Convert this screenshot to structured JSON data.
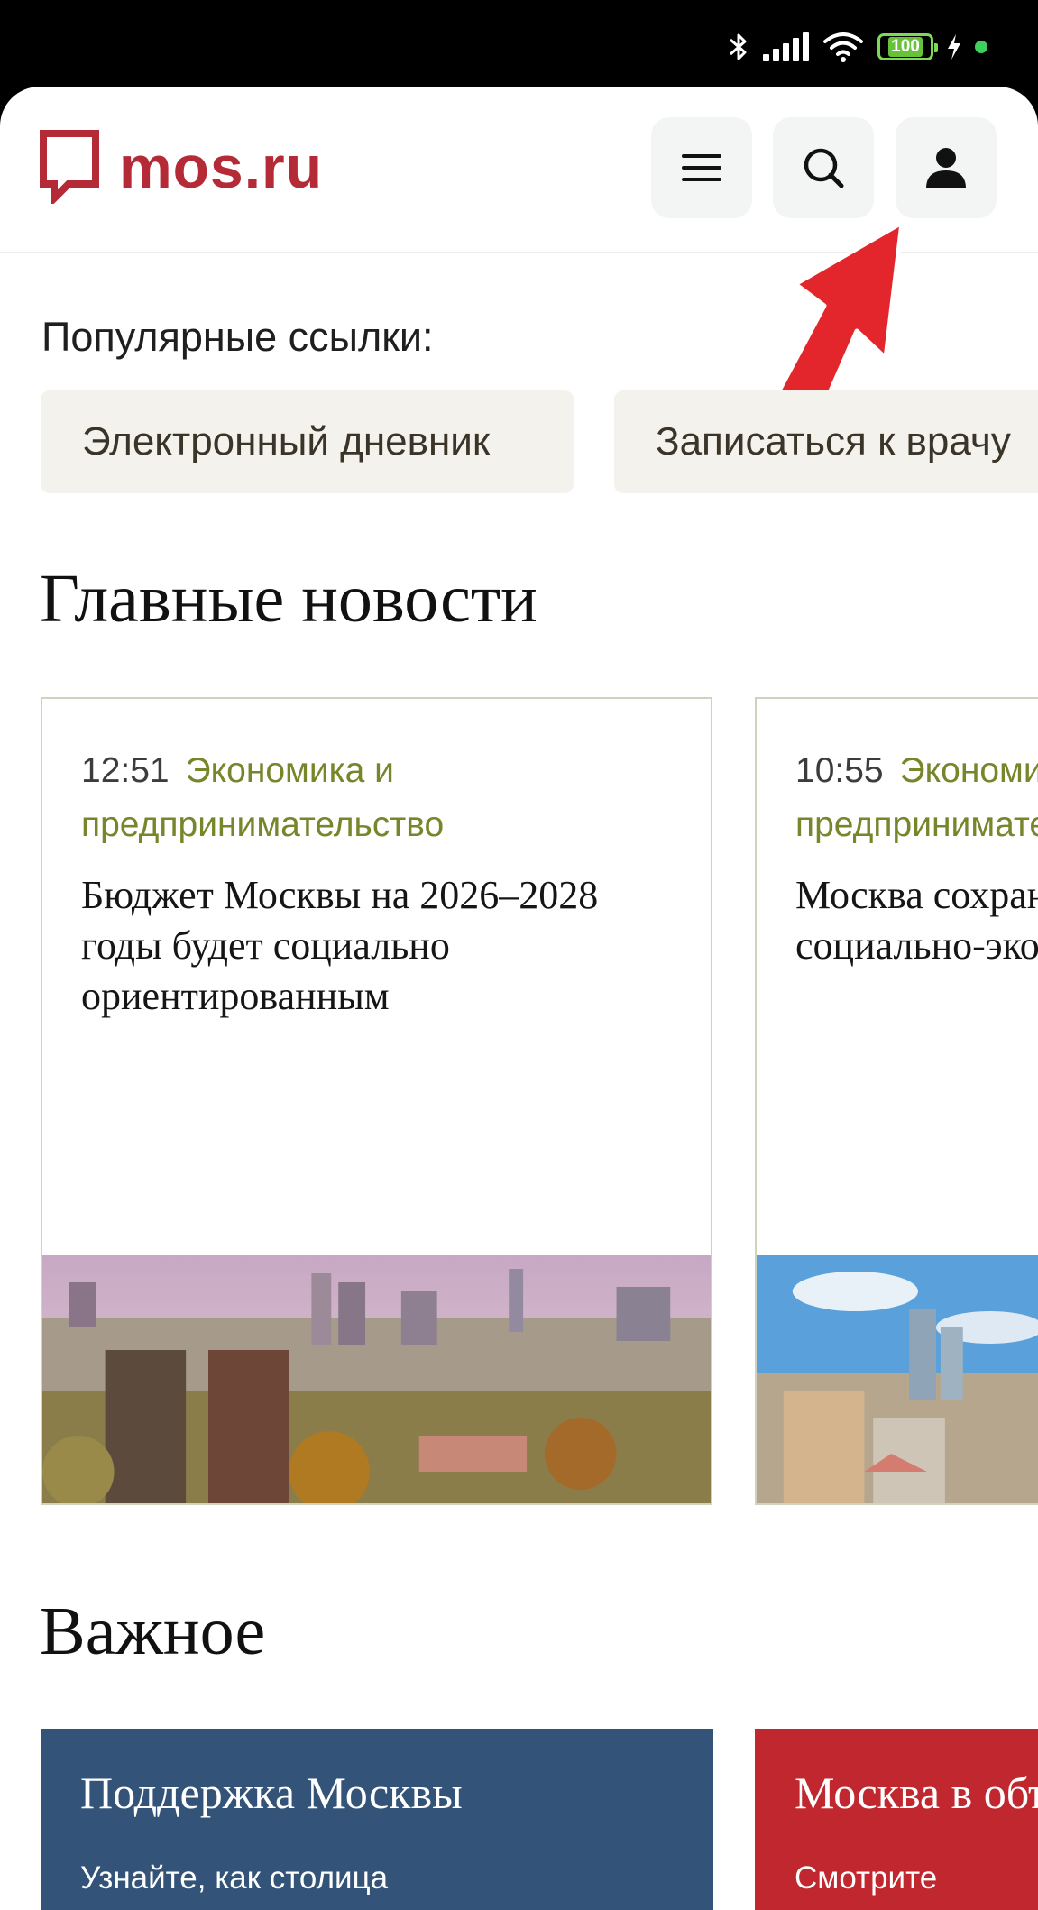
{
  "status_bar": {
    "battery": "100"
  },
  "header": {
    "logo_text": "mos.ru"
  },
  "popular": {
    "label": "Популярные ссылки:",
    "links": [
      "Электронный дневник",
      "Записаться к врачу"
    ]
  },
  "news": {
    "title": "Главные новости",
    "items": [
      {
        "time": "12:51",
        "category": "Экономика и предпринимательство",
        "headline": "Бюджет Москвы на 2026–2028 годы будет социально ориентированным"
      },
      {
        "time": "10:55",
        "category": "Экономика и предпринимательство",
        "headline": "Москва сохраняет динамику социально-экономического"
      }
    ]
  },
  "important": {
    "title": "Важное",
    "items": [
      {
        "title": "Поддержка Москвы",
        "text": "Узнайте, как столица"
      },
      {
        "title": "Москва в объективе",
        "text": "Смотрите"
      }
    ]
  },
  "colors": {
    "brand": "#b52a37",
    "category": "#76862a",
    "blue_card": "#335478",
    "red_card": "#c0272f"
  },
  "icons": [
    "bluetooth-icon",
    "signal-icon",
    "wifi-icon",
    "battery-icon",
    "charging-icon",
    "menu-icon",
    "search-icon",
    "user-icon",
    "arrow-pointer"
  ]
}
